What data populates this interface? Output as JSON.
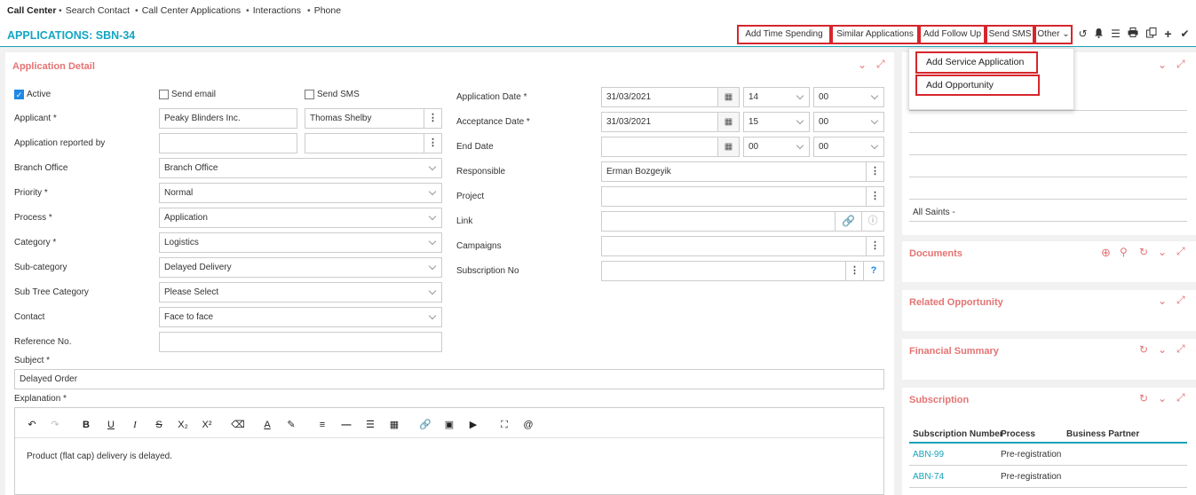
{
  "nav": {
    "brand": "Call Center",
    "items": [
      "Search Contact",
      "Call Center Applications",
      "Interactions",
      "Phone"
    ]
  },
  "page_title": "APPLICATIONS: SBN-34",
  "toolbar": {
    "buttons": [
      "Add Time Spending",
      "Similar Applications",
      "Add Follow Up",
      "Send SMS",
      "Other"
    ],
    "icons": [
      "history-icon",
      "bell-icon",
      "list-icon",
      "print-icon",
      "copy-icon",
      "plus-icon",
      "check-icon"
    ]
  },
  "dropdown": {
    "items": [
      "Add Service Application",
      "Add Opportunity"
    ]
  },
  "detail": {
    "title": "Application Detail",
    "active_label": "Active",
    "active_checked": true,
    "send_email_label": "Send email",
    "send_sms_label": "Send SMS",
    "applicant_label": "Applicant *",
    "applicant_company": "Peaky Blinders Inc.",
    "applicant_person": "Thomas Shelby",
    "reported_by_label": "Application reported by",
    "branch_label": "Branch Office",
    "branch_value": "Branch Office",
    "priority_label": "Priority *",
    "priority_value": "Normal",
    "process_label": "Process *",
    "process_value": "Application",
    "category_label": "Category *",
    "category_value": "Logistics",
    "subcategory_label": "Sub-category",
    "subcategory_value": "Delayed Delivery",
    "subtree_label": "Sub Tree Category",
    "subtree_value": "Please Select",
    "contact_label": "Contact",
    "contact_value": "Face to face",
    "reference_label": "Reference No.",
    "reference_value": "",
    "app_date_label": "Application Date *",
    "app_date_value": "31/03/2021",
    "app_hour": "14",
    "app_min": "00",
    "acc_date_label": "Acceptance Date *",
    "acc_date_value": "31/03/2021",
    "acc_hour": "15",
    "acc_min": "00",
    "end_date_label": "End Date",
    "end_date_value": "",
    "end_hour": "00",
    "end_min": "00",
    "responsible_label": "Responsible",
    "responsible_value": "Erman Bozgeyik",
    "project_label": "Project",
    "link_label": "Link",
    "campaigns_label": "Campaigns",
    "subscription_label": "Subscription No",
    "subject_label": "Subject *",
    "subject_value": "Delayed Order",
    "explanation_label": "Explanation *",
    "explanation_text": "Product (flat cap) delivery is delayed."
  },
  "side": {
    "top_value": "All Saints -",
    "documents_title": "Documents",
    "related_title": "Related Opportunity",
    "financial_title": "Financial Summary",
    "subscription_title": "Subscription",
    "subscription_columns": [
      "Subscription Number",
      "Process",
      "Business Partner"
    ],
    "subscription_rows": [
      {
        "number": "ABN-99",
        "process": "Pre-registration",
        "partner": ""
      },
      {
        "number": "ABN-74",
        "process": "Pre-registration",
        "partner": ""
      }
    ]
  },
  "colors": {
    "accent": "#13a6c2",
    "panel_title": "#e57373",
    "highlight": "#d6262c"
  }
}
